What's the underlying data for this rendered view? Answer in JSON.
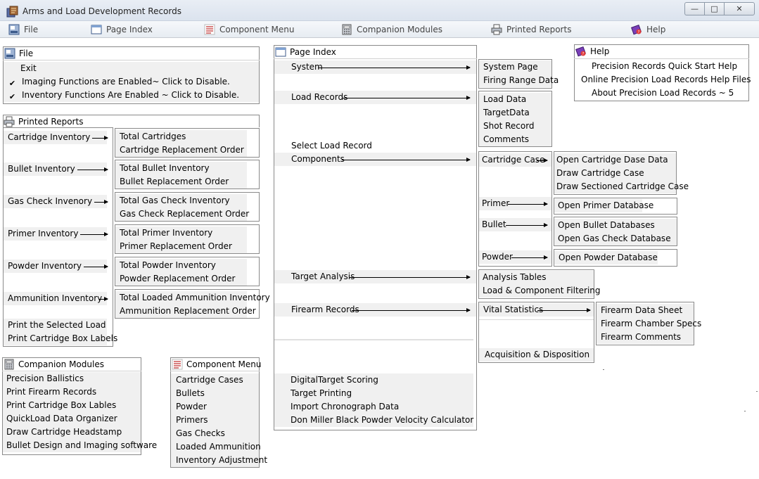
{
  "window": {
    "title": "Arms and Load Development Records",
    "minimize_glyph": "—",
    "maximize_glyph": "□",
    "close_glyph": "✕"
  },
  "menubar": {
    "items": [
      {
        "label": "File",
        "icon": "file-icon"
      },
      {
        "label": "Page Index",
        "icon": "window-icon"
      },
      {
        "label": "Component Menu",
        "icon": "list-icon"
      },
      {
        "label": "Companion Modules",
        "icon": "calculator-icon"
      },
      {
        "label": "Printed Reports",
        "icon": "printer-icon"
      },
      {
        "label": "Help",
        "icon": "help-book-icon"
      }
    ]
  },
  "file_panel": {
    "title": "File",
    "items": [
      {
        "label": "Exit"
      },
      {
        "label": "Imaging Functions are Enabled~ Click to Disable.",
        "checked": true
      },
      {
        "label": "Inventory Functions Are Enabled ~ Click to Disable.",
        "checked": true
      }
    ],
    "check_glyph": "✔"
  },
  "printed_reports": {
    "title": "Printed Reports",
    "groups": [
      {
        "label": "Cartridge Inventory",
        "subs": [
          "Total Cartridges",
          "Cartridge Replacement Order"
        ]
      },
      {
        "label": "Bullet Inventory",
        "subs": [
          "Total Bullet Inventory",
          "Bullet Replacement Order"
        ]
      },
      {
        "label": "Gas Check Invenory",
        "subs": [
          "Total Gas Check Inventory",
          "Gas Check Replacement Order"
        ]
      },
      {
        "label": "Primer Inventory",
        "subs": [
          "Total Primer Inventory",
          "Primer Replacement Order"
        ]
      },
      {
        "label": "Powder Inventory",
        "subs": [
          "Total Powder Inventory",
          "Powder Replacement Order"
        ]
      },
      {
        "label": "Ammunition Inventory",
        "subs": [
          "Total Loaded Ammunition Inventory",
          "Ammunition Replacement Order"
        ]
      }
    ],
    "extra": [
      "Print the Selected Load",
      "Print Cartridge Box Labels"
    ]
  },
  "companion_modules": {
    "title": "Companion Modules",
    "items": [
      "Precision Ballistics",
      "Print Firearm Records",
      "Print Cartridge Box Lables",
      "QuickLoad Data Organizer",
      "Draw Cartridge Headstamp",
      "Bullet Design and Imaging software"
    ]
  },
  "component_menu": {
    "title": "Component Menu",
    "items": [
      "Cartridge Cases",
      "Bullets",
      "Powder",
      "Primers",
      "Gas Checks",
      "Loaded Ammunition",
      "Inventory Adjustment"
    ]
  },
  "page_index": {
    "title": "Page Index",
    "system": {
      "label": "System",
      "subs": [
        "System Page",
        "Firing Range Data"
      ]
    },
    "load_records": {
      "label": "Load Records",
      "subs": [
        "Load Data",
        "TargetData",
        "Shot Record",
        "Comments"
      ]
    },
    "select_load_record": "Select Load Record",
    "components": {
      "label": "Components",
      "cartridge_case": {
        "label": "Cartridge Case",
        "subs": [
          "Open Cartridge Dase Data",
          "Draw Cartridge Case",
          "Draw Sectioned Cartridge Case"
        ]
      },
      "primer": {
        "label": "Primer",
        "subs": [
          "Open Primer Database"
        ]
      },
      "bullet": {
        "label": "Bullet",
        "subs": [
          "Open Bullet Databases",
          "Open Gas Check Database"
        ]
      },
      "powder": {
        "label": "Powder",
        "subs": [
          "Open Powder Database"
        ]
      }
    },
    "target_analysis": {
      "label": "Target Analysis",
      "subs": [
        "Analysis Tables",
        "Load & Component Filtering"
      ]
    },
    "firearm_records": {
      "label": "Firearm Records",
      "vital_statistics": {
        "label": "Vital Statistics",
        "subs": [
          "Firearm Data Sheet",
          "Firearm Chamber Specs",
          "Firearm Comments"
        ]
      },
      "acquisition": "Acquisition & Disposition"
    },
    "bottom": [
      "DigitalTarget Scoring",
      "Target Printing",
      "Import Chronograph  Data",
      "Don Miller Black Powder Velocity Calculator"
    ]
  },
  "help": {
    "title": "Help",
    "items": [
      "Precision Records Quick Start Help",
      "Online Precision Load Records Help  Files",
      "About Precision Load Records ~ 5"
    ]
  }
}
